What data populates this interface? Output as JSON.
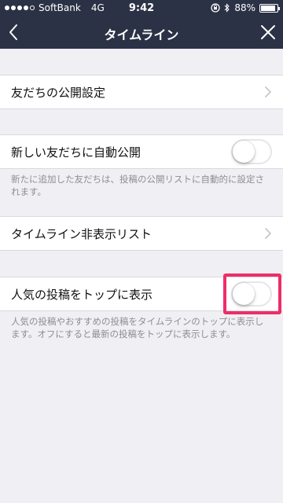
{
  "status_bar": {
    "carrier": "SoftBank",
    "network": "4G",
    "time": "9:42",
    "battery_percent": "88%",
    "battery_level": 0.88,
    "signal_filled": 4,
    "signal_total": 5
  },
  "nav": {
    "title": "タイムライン",
    "back_icon": "chevron-left-icon",
    "close_icon": "close-icon"
  },
  "settings": {
    "friends_visibility": {
      "label": "友だちの公開設定"
    },
    "auto_publish": {
      "label": "新しい友だちに自動公開",
      "enabled": false,
      "description": "新たに追加した友だちは、投稿の公開リストに自動的に設定されます。"
    },
    "hidden_list": {
      "label": "タイムライン非表示リスト"
    },
    "popular_top": {
      "label": "人気の投稿をトップに表示",
      "enabled": false,
      "description": "人気の投稿やおすすめの投稿をタイムラインのトップに表示します。オフにすると最新の投稿をトップに表示します。"
    }
  },
  "colors": {
    "nav_background": "#2b3245",
    "page_background": "#efeff4",
    "highlight": "#ef2d68"
  }
}
